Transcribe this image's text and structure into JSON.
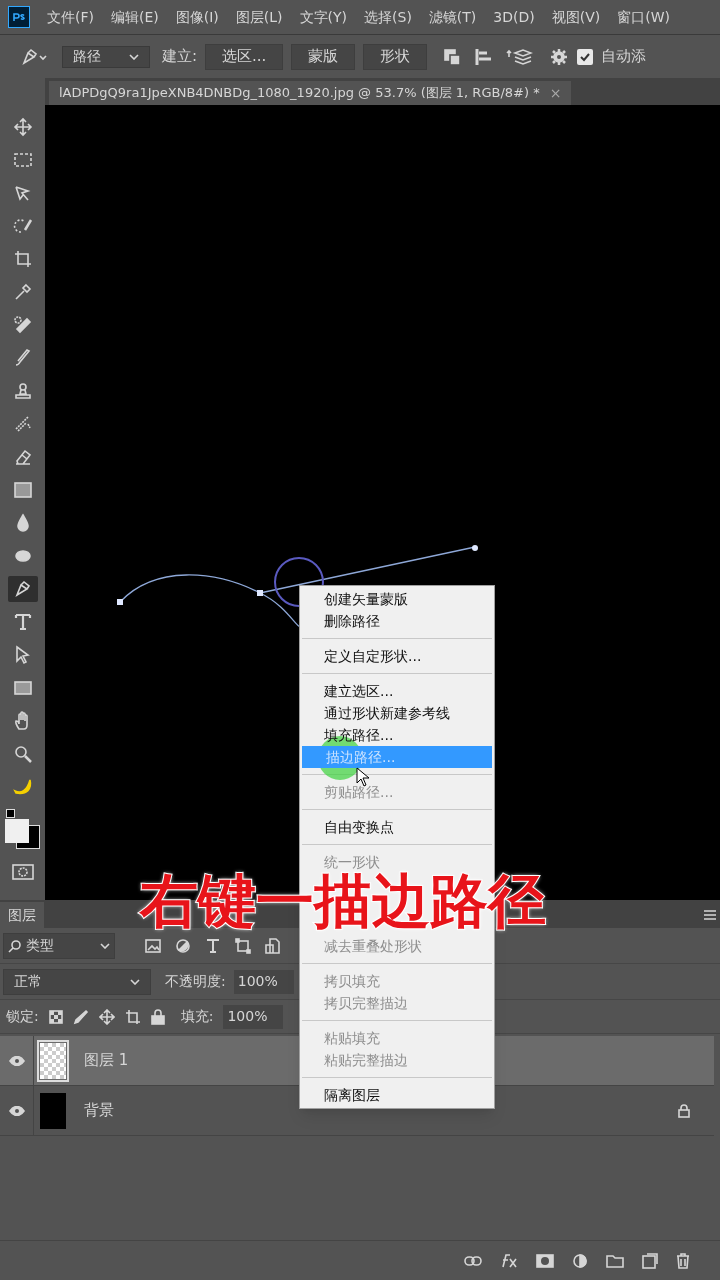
{
  "menu_bar": {
    "items": [
      "文件(F)",
      "编辑(E)",
      "图像(I)",
      "图层(L)",
      "文字(Y)",
      "选择(S)",
      "滤镜(T)",
      "3D(D)",
      "视图(V)",
      "窗口(W)"
    ]
  },
  "options_bar": {
    "mode": "路径",
    "make_label": "建立:",
    "buttons": [
      "选区...",
      "蒙版",
      "形状"
    ],
    "auto_add": {
      "label": "自动添",
      "checked": true
    }
  },
  "document_tab": {
    "title": "lADPDgQ9ra1JpeXNB4DNBDg_1080_1920.jpg @ 53.7% (图层 1, RGB/8#) *",
    "close": "×"
  },
  "tools": [
    {
      "selected": false
    },
    {
      "selected": false
    },
    {
      "selected": false
    },
    {
      "selected": false
    },
    {
      "selected": false
    },
    {
      "selected": false
    },
    {
      "selected": false
    },
    {
      "selected": false
    },
    {
      "selected": false
    },
    {
      "selected": false
    },
    {
      "selected": false
    },
    {
      "selected": false
    },
    {
      "selected": false
    },
    {
      "selected": false
    },
    {
      "selected": true
    },
    {
      "selected": false
    },
    {
      "selected": false
    },
    {
      "selected": false
    },
    {
      "selected": false
    },
    {
      "selected": false
    },
    {
      "selected": false
    }
  ],
  "context_menu": {
    "groups": [
      [
        {
          "label": "创建矢量蒙版",
          "disabled": false,
          "selected": false
        },
        {
          "label": "删除路径",
          "disabled": false,
          "selected": false
        }
      ],
      [
        {
          "label": "定义自定形状...",
          "disabled": false,
          "selected": false
        }
      ],
      [
        {
          "label": "建立选区...",
          "disabled": false,
          "selected": false
        },
        {
          "label": "通过形状新建参考线",
          "disabled": false,
          "selected": false
        },
        {
          "label": "填充路径...",
          "disabled": false,
          "selected": false
        },
        {
          "label": "描边路径...",
          "disabled": false,
          "selected": true
        }
      ],
      [
        {
          "label": "剪贴路径...",
          "disabled": true,
          "selected": false
        }
      ],
      [
        {
          "label": "自由变换点",
          "disabled": false,
          "selected": false
        }
      ],
      [
        {
          "label": "统一形状",
          "disabled": true,
          "selected": false
        },
        {
          "label": "减去重叠处形状",
          "disabled": true,
          "selected": false
        }
      ],
      [
        {
          "label": "拷贝填充",
          "disabled": true,
          "selected": false
        },
        {
          "label": "拷贝完整描边",
          "disabled": true,
          "selected": false
        }
      ],
      [
        {
          "label": "粘贴填充",
          "disabled": true,
          "selected": false
        },
        {
          "label": "粘贴完整描边",
          "disabled": true,
          "selected": false
        }
      ],
      [
        {
          "label": "隔离图层",
          "disabled": false,
          "selected": false
        }
      ]
    ]
  },
  "caption": "右键一描边路径",
  "layers_panel": {
    "tab": "图层",
    "filter": "类型",
    "blend_mode": "正常",
    "opacity_label": "不透明度:",
    "opacity": "100%",
    "lock_label": "锁定:",
    "fill_label": "填充:",
    "fill": "100%",
    "layers": [
      {
        "name": "图层 1",
        "kind": "transparent",
        "selected": true,
        "visible": true,
        "locked": false
      },
      {
        "name": "背景",
        "kind": "black",
        "selected": false,
        "visible": true,
        "locked": true
      }
    ]
  }
}
